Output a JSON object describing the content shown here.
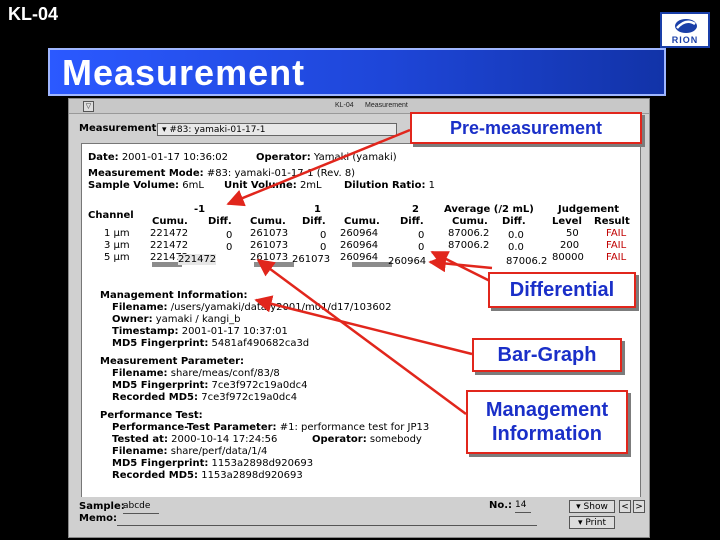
{
  "slide": {
    "id": "KL-04",
    "banner_title": "Measurement",
    "logo_text": "RION"
  },
  "window": {
    "title": "KL-04",
    "subtitle": "Measurement",
    "measurement_label": "Measurement:",
    "measurement_value": "#83: yamaki-01-17-1"
  },
  "report": {
    "date_label": "Date:",
    "date_value": "2001-01-17 10:36:02",
    "operator_label": "Operator:",
    "operator_value": "Yamaki (yamaki)",
    "mode_label": "Measurement Mode:",
    "mode_value": "#83: yamaki-01-17-1 (Rev. 8)",
    "sample_volume_label": "Sample Volume:",
    "sample_volume_value": "6mL",
    "unit_volume_label": "Unit Volume:",
    "unit_volume_value": "2mL",
    "dilution_label": "Dilution Ratio:",
    "dilution_value": "1",
    "table": {
      "group1": "-1",
      "group2": "1",
      "group3": "2",
      "average_label": "Average (/2 mL)",
      "judgement_label": "Judgement",
      "channel_label": "Channel",
      "cumu": "Cumu.",
      "diff": "Diff.",
      "level": "Level",
      "result": "Result",
      "rows": [
        {
          "ch": "1 μm",
          "c1": "221472",
          "d1": "0",
          "c2": "261073",
          "d2": "0",
          "c3": "260964",
          "d3": "0",
          "avg_c": "87006.2",
          "avg_d": "0.0",
          "level": "50",
          "result": "FAIL"
        },
        {
          "ch": "3 μm",
          "c1": "221472",
          "d1": "0",
          "c2": "261073",
          "d2": "0",
          "c3": "260964",
          "d3": "0",
          "avg_c": "87006.2",
          "avg_d": "0.0",
          "level": "200",
          "result": "FAIL"
        },
        {
          "ch": "5 μm",
          "c1": "221472",
          "d1": "",
          "c2": "261073",
          "d2": "",
          "c3": "260964",
          "d3": "",
          "avg_c": "87006.2",
          "avg_d": "",
          "level": "80000",
          "result": "FAIL"
        }
      ],
      "bar_values": {
        "v1": "221472",
        "v2": "261073",
        "v3": "260964"
      }
    },
    "mgmt": {
      "header": "Management Information:",
      "filename_label": "Filename:",
      "filename_value": "/users/yamaki/data/y2001/m01/d17/103602",
      "owner_label": "Owner:",
      "owner_value": "yamaki / kangi_b",
      "timestamp_label": "Timestamp:",
      "timestamp_value": "2001-01-17 10:37:01",
      "md5_label": "MD5 Fingerprint:",
      "md5_value": "5481af490682ca3d"
    },
    "param": {
      "header": "Measurement Parameter:",
      "filename_label": "Filename:",
      "filename_value": "share/meas/conf/83/8",
      "md5_label": "MD5 Fingerprint:",
      "md5_value": "7ce3f972c19a0dc4",
      "rec_label": "Recorded MD5:",
      "rec_value": "7ce3f972c19a0dc4"
    },
    "perf": {
      "header": "Performance Test:",
      "param_label": "Performance-Test Parameter:",
      "param_value": "#1: performance test for JP13",
      "tested_label": "Tested at:",
      "tested_value": "2000-10-14 17:24:56",
      "operator_label": "Operator:",
      "operator_value": "somebody",
      "filename_label": "Filename:",
      "filename_value": "share/perf/data/1/4",
      "md5_label": "MD5 Fingerprint:",
      "md5_value": "1153a2898d920693",
      "rec_label": "Recorded MD5:",
      "rec_value": "1153a2898d920693"
    }
  },
  "bottom": {
    "sample_label": "Sample:",
    "sample_value": "abcde",
    "memo_label": "Memo:",
    "no_label": "No.:",
    "no_value": "14",
    "show_button": "▾ Show",
    "print_button": "▾ Print",
    "prev_button": "<",
    "next_button": ">"
  },
  "callouts": {
    "pre": "Pre-measurement",
    "diff": "Differential",
    "bar": "Bar-Graph",
    "mgmt": "Management\nInformation"
  },
  "colors": {
    "banner": "#2b59ff",
    "callout_border": "#e1261c",
    "callout_text": "#1a2fc8",
    "fail": "#c00000"
  }
}
